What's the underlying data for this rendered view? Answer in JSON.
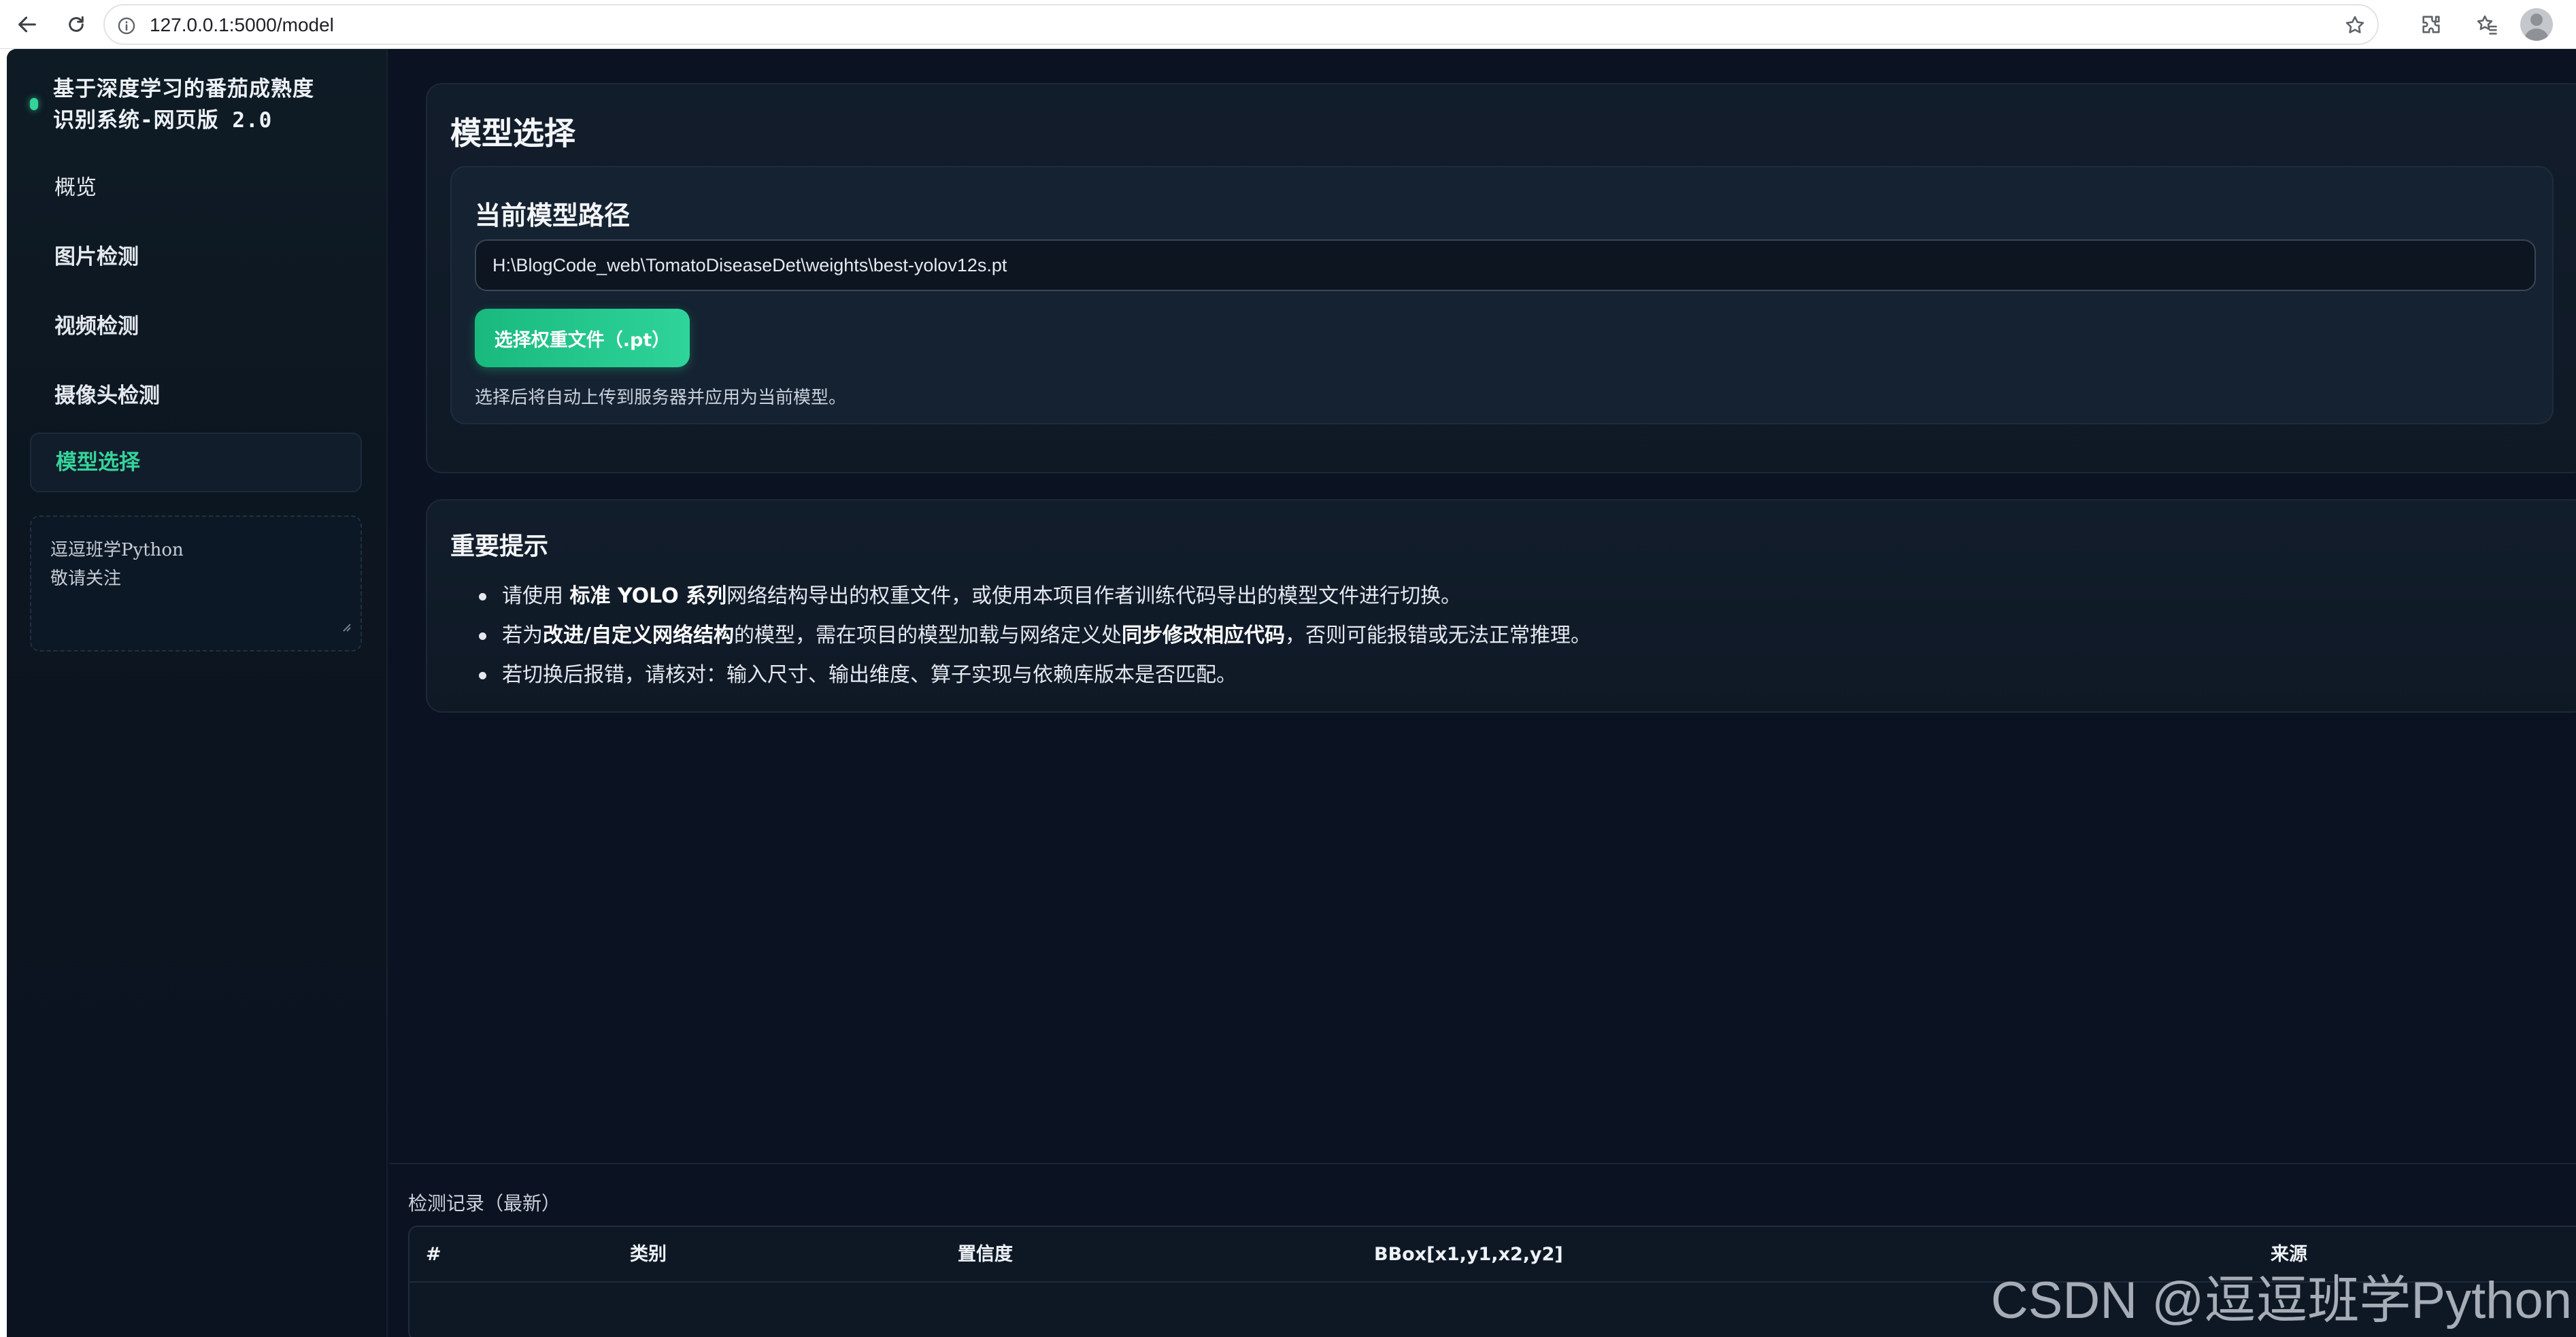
{
  "browser": {
    "url": "127.0.0.1:5000/model"
  },
  "sidebar": {
    "brand_title": "基于深度学习的番茄成熟度\n识别系统-网页版 2.0",
    "items": [
      {
        "label": "概览"
      },
      {
        "label": "图片检测"
      },
      {
        "label": "视频检测"
      },
      {
        "label": "摄像头检测"
      },
      {
        "label": "模型选择"
      }
    ],
    "active_item": "模型选择",
    "note_line1": "逗逗班学Python",
    "note_line2": "敬请关注"
  },
  "model_panel": {
    "title": "模型选择",
    "current_path_title": "当前模型路径",
    "current_path_value": "H:\\BlogCode_web\\TomatoDiseaseDet\\weights\\best-yolov12s.pt",
    "pick_button_label": "选择权重文件（.pt）",
    "hint": "选择后将自动上传到服务器并应用为当前模型。"
  },
  "tips_panel": {
    "title": "重要提示",
    "tip1_a": "请使用 ",
    "tip1_b": "标准 YOLO 系列",
    "tip1_c": "网络结构导出的权重文件，或使用本项目作者训练代码导出的模型文件进行切换。",
    "tip2_a": "若为",
    "tip2_b": "改进/自定义网络结构",
    "tip2_c": "的模型，需在项目的模型加载与网络定义处",
    "tip2_d": "同步修改相应代码",
    "tip2_e": "，否则可能报错或无法正常推理。",
    "tip3": "若切换后报错，请核对：输入尺寸、输出维度、算子实现与依赖库版本是否匹配。"
  },
  "records": {
    "title": "检测记录（最新）",
    "columns": [
      "#",
      "类别",
      "置信度",
      "BBox[x1,y1,x2,y2]",
      "来源"
    ]
  },
  "watermark": "CSDN @逗逗班学Python",
  "colors": {
    "accent": "#34d399",
    "background": "#0b1322"
  }
}
